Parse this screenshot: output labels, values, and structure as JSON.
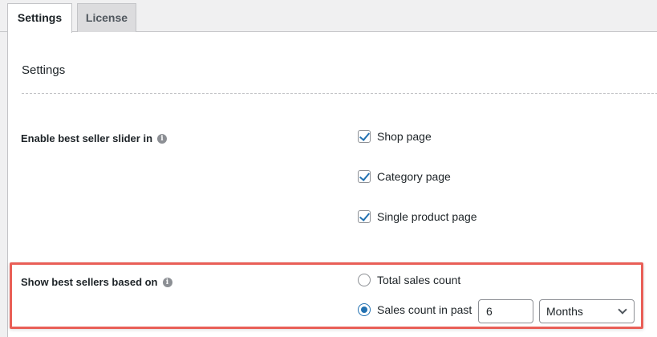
{
  "tabs": [
    {
      "label": "Settings",
      "active": true
    },
    {
      "label": "License",
      "active": false
    }
  ],
  "section": {
    "title": "Settings"
  },
  "slider_row": {
    "label": "Enable best seller slider in",
    "info_icon": "info-icon",
    "options": [
      {
        "label": "Shop page",
        "checked": true
      },
      {
        "label": "Category page",
        "checked": true
      },
      {
        "label": "Single product page",
        "checked": true
      }
    ]
  },
  "basis_row": {
    "label": "Show best sellers based on",
    "info_icon": "info-icon",
    "options": [
      {
        "label": "Total sales count",
        "selected": false
      },
      {
        "label": "Sales count in past",
        "selected": true
      }
    ],
    "past_value": "6",
    "period_selected": "Months"
  },
  "colors": {
    "accent": "#2271b1",
    "highlight": "#e95f57"
  }
}
